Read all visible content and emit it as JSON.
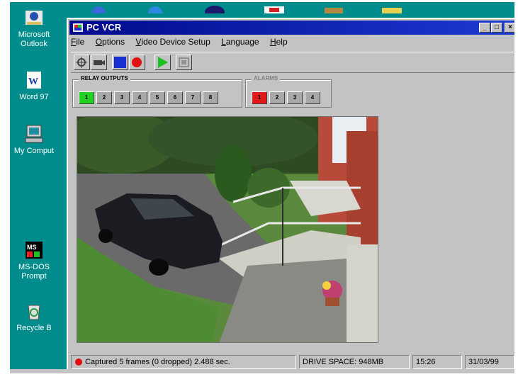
{
  "desktop": {
    "icons": [
      {
        "label": "Microsoft Outlook",
        "line1": "Microsoft",
        "line2": "Outlook",
        "icon": "outlook-icon"
      },
      {
        "label": "Word 97",
        "line1": "Word 97",
        "line2": "",
        "icon": "word-icon"
      },
      {
        "label": "My Computer",
        "line1": "My Comput",
        "line2": "",
        "icon": "computer-icon"
      },
      {
        "label": "MS-DOS Prompt",
        "line1": "MS-DOS",
        "line2": "Prompt",
        "icon": "msdos-icon"
      },
      {
        "label": "Recycle Bin",
        "line1": "Recycle B",
        "line2": "",
        "icon": "recycle-bin-icon"
      }
    ]
  },
  "window": {
    "title": "PC VCR",
    "menu": [
      {
        "label": "File",
        "accel": "F",
        "rest": "ile"
      },
      {
        "label": "Options",
        "accel": "O",
        "rest": "ptions"
      },
      {
        "label": "Video Device Setup",
        "accel": "V",
        "rest": "ideo Device Setup"
      },
      {
        "label": "Language",
        "accel": "L",
        "rest": "anguage"
      },
      {
        "label": "Help",
        "accel": "H",
        "rest": "elp"
      }
    ],
    "toolbar": {
      "buttons": [
        "settings-icon",
        "camera-icon",
        "stop-icon",
        "record-icon",
        "play-icon",
        "snapshot-icon"
      ],
      "colors": {
        "stop": "#1a2fd6",
        "record": "#e01010",
        "play": "#18c020"
      }
    },
    "relay_outputs": {
      "label": "RELAY OUTPUTS",
      "channels": [
        "1",
        "2",
        "3",
        "4",
        "5",
        "6",
        "7",
        "8"
      ],
      "active": "1",
      "active_color": "#22d022"
    },
    "alarms": {
      "label": "ALARMS",
      "channels": [
        "1",
        "2",
        "3",
        "4"
      ],
      "active": "1",
      "active_color": "#e01a1a"
    },
    "status": {
      "capture_text": "Captured 5 frames (0 dropped) 2.488 sec.",
      "drive_space": "DRIVE SPACE: 948MB",
      "time": "15:26",
      "date": "31/03/99"
    }
  }
}
